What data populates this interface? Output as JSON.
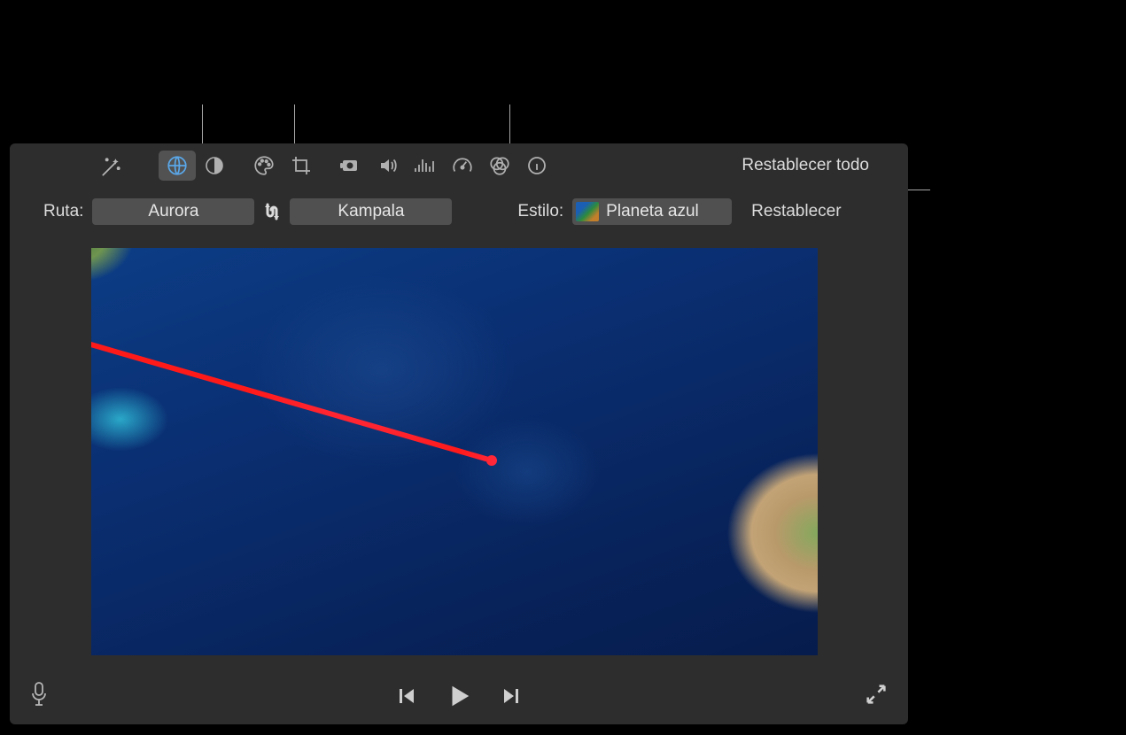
{
  "toolbar": {
    "reset_all": "Restablecer todo"
  },
  "route": {
    "label": "Ruta:",
    "start": "Aurora",
    "end": "Kampala"
  },
  "style": {
    "label": "Estilo:",
    "value": "Planeta azul",
    "reset": "Restablecer"
  }
}
